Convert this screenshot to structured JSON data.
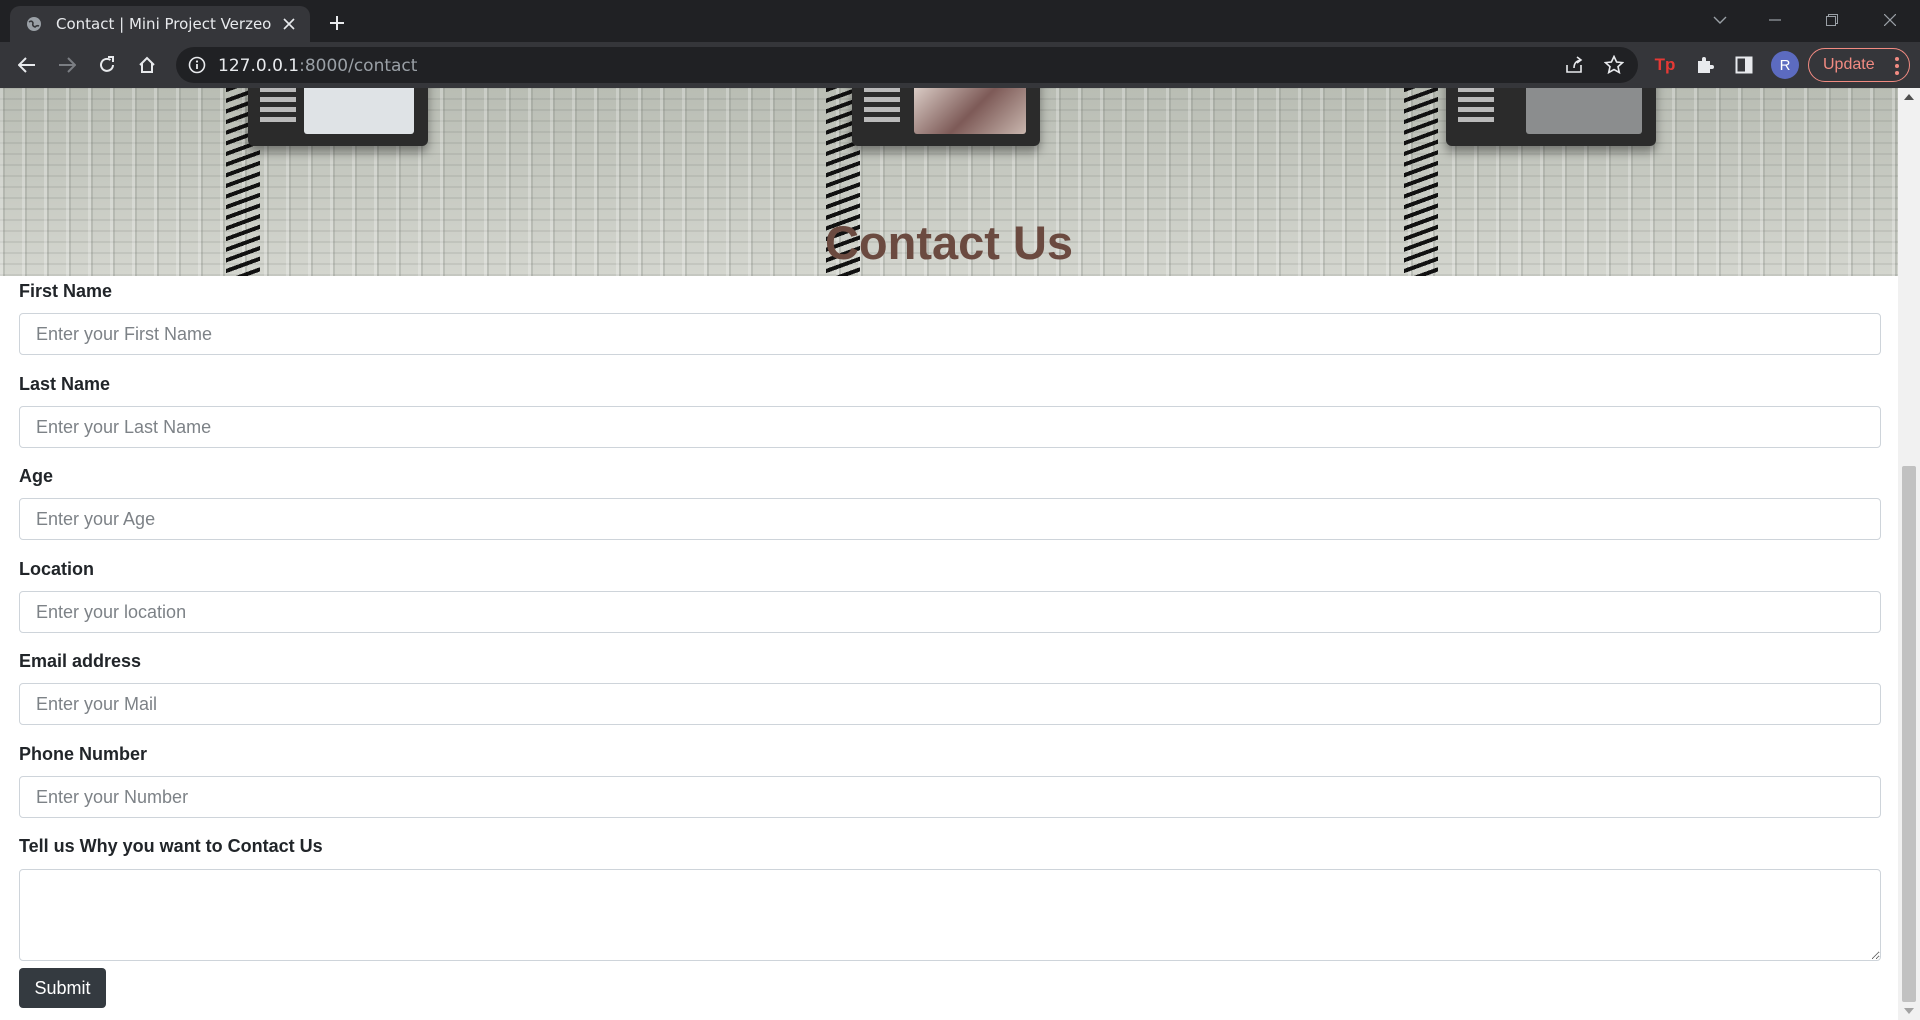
{
  "browser": {
    "tab_title": "Contact | Mini Project Verzeo",
    "url_host": "127.0.0.1",
    "url_path": ":8000/contact",
    "update_label": "Update",
    "profile_initial": "R",
    "extension_label": "Tp"
  },
  "hero": {
    "title": "Contact Us"
  },
  "form": {
    "fields": [
      {
        "label": "First Name",
        "placeholder": "Enter your First Name"
      },
      {
        "label": "Last Name",
        "placeholder": "Enter your Last Name"
      },
      {
        "label": "Age",
        "placeholder": "Enter your Age"
      },
      {
        "label": "Location",
        "placeholder": "Enter your location"
      },
      {
        "label": "Email address",
        "placeholder": "Enter your Mail"
      },
      {
        "label": "Phone Number",
        "placeholder": "Enter your Number"
      }
    ],
    "message_label": "Tell us Why you want to Contact Us",
    "message_value": "",
    "submit_label": "Submit"
  },
  "colors": {
    "title": "#6b4a40",
    "submit_bg": "#343a40",
    "update_accent": "#f28b82"
  }
}
